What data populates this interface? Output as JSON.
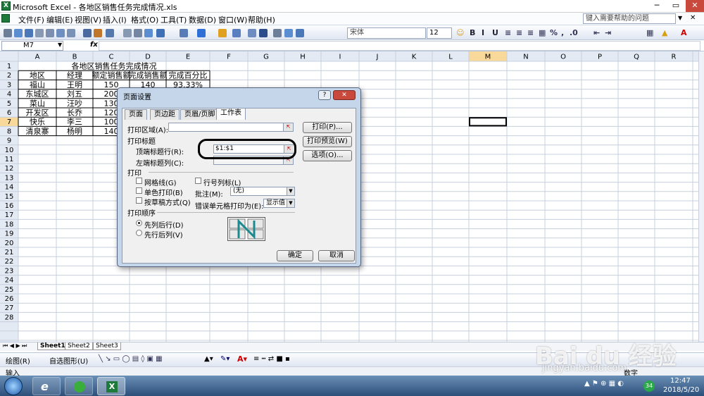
{
  "window": {
    "title": "Microsoft Excel - 各地区销售任务完成情况.xls"
  },
  "menu": [
    "文件(F)",
    "编辑(E)",
    "视图(V)",
    "插入(I)",
    "格式(O)",
    "工具(T)",
    "数据(D)",
    "窗口(W)",
    "帮助(H)"
  ],
  "help_placeholder": "键入需要帮助的问题",
  "font": {
    "name": "宋体",
    "size": "12"
  },
  "namebox": "M7",
  "fx": "fx",
  "columns": [
    "A",
    "B",
    "C",
    "D",
    "E",
    "F",
    "G",
    "H",
    "I",
    "J",
    "K",
    "L",
    "M",
    "N",
    "O",
    "P",
    "Q",
    "R"
  ],
  "rows": [
    "1",
    "2",
    "3",
    "4",
    "5",
    "6",
    "7",
    "8",
    "9",
    "10",
    "11",
    "12",
    "13",
    "14",
    "15",
    "16",
    "17",
    "18",
    "19",
    "20",
    "21",
    "22",
    "23",
    "24",
    "25",
    "26",
    "27",
    "28"
  ],
  "cells": {
    "title": "各地区销售任务完成情况",
    "header": [
      "地区",
      "经理",
      "额定销售额",
      "完成销售额",
      "完成百分比"
    ],
    "data": [
      [
        "福山",
        "王明",
        "150",
        "140",
        "93.33%"
      ],
      [
        "东城区",
        "刘五",
        "200",
        "",
        ""
      ],
      [
        "菜山",
        "汪吵",
        "130",
        "",
        ""
      ],
      [
        "开发区",
        "长乔",
        "120",
        "",
        ""
      ],
      [
        "快乐",
        "李三",
        "100",
        "",
        ""
      ],
      [
        "清泉寨",
        "杨明",
        "140",
        "",
        ""
      ]
    ]
  },
  "sheets": [
    "Sheet1",
    "Sheet2",
    "Sheet3"
  ],
  "status": {
    "left": "输入",
    "right": "数字"
  },
  "drawbar": {
    "draw": "绘图(R)",
    "autoshape": "自选图形(U)"
  },
  "dialog": {
    "title": "页面设置",
    "tabs": [
      "页面",
      "页边距",
      "页眉/页脚",
      "工作表"
    ],
    "print_area_label": "打印区域(A):",
    "print_titles_label": "打印标题",
    "top_rows_label": "顶端标题行(R):",
    "top_rows_value": "$1:$1",
    "left_cols_label": "左端标题列(C):",
    "print_label": "打印",
    "gridlines": "网格线(G)",
    "bw": "单色打印(B)",
    "draft": "按草稿方式(Q)",
    "rowcol": "行号列标(L)",
    "comments_label": "批注(M):",
    "comments_value": "(无)",
    "errors_label": "错误单元格打印为(E):",
    "errors_value": "显示值",
    "order_label": "打印顺序",
    "down_then_over": "先列后行(D)",
    "over_then_down": "先行后列(V)",
    "btn_print": "打印(P)...",
    "btn_preview": "打印预览(W)",
    "btn_options": "选项(O)...",
    "btn_ok": "确定",
    "btn_cancel": "取消"
  },
  "taskbar": {
    "time": "12:47",
    "date": "2018/5/20",
    "badge": "34"
  },
  "watermark": {
    "brand": "Bai du 经验",
    "url": "jingyan.baidu.com"
  }
}
